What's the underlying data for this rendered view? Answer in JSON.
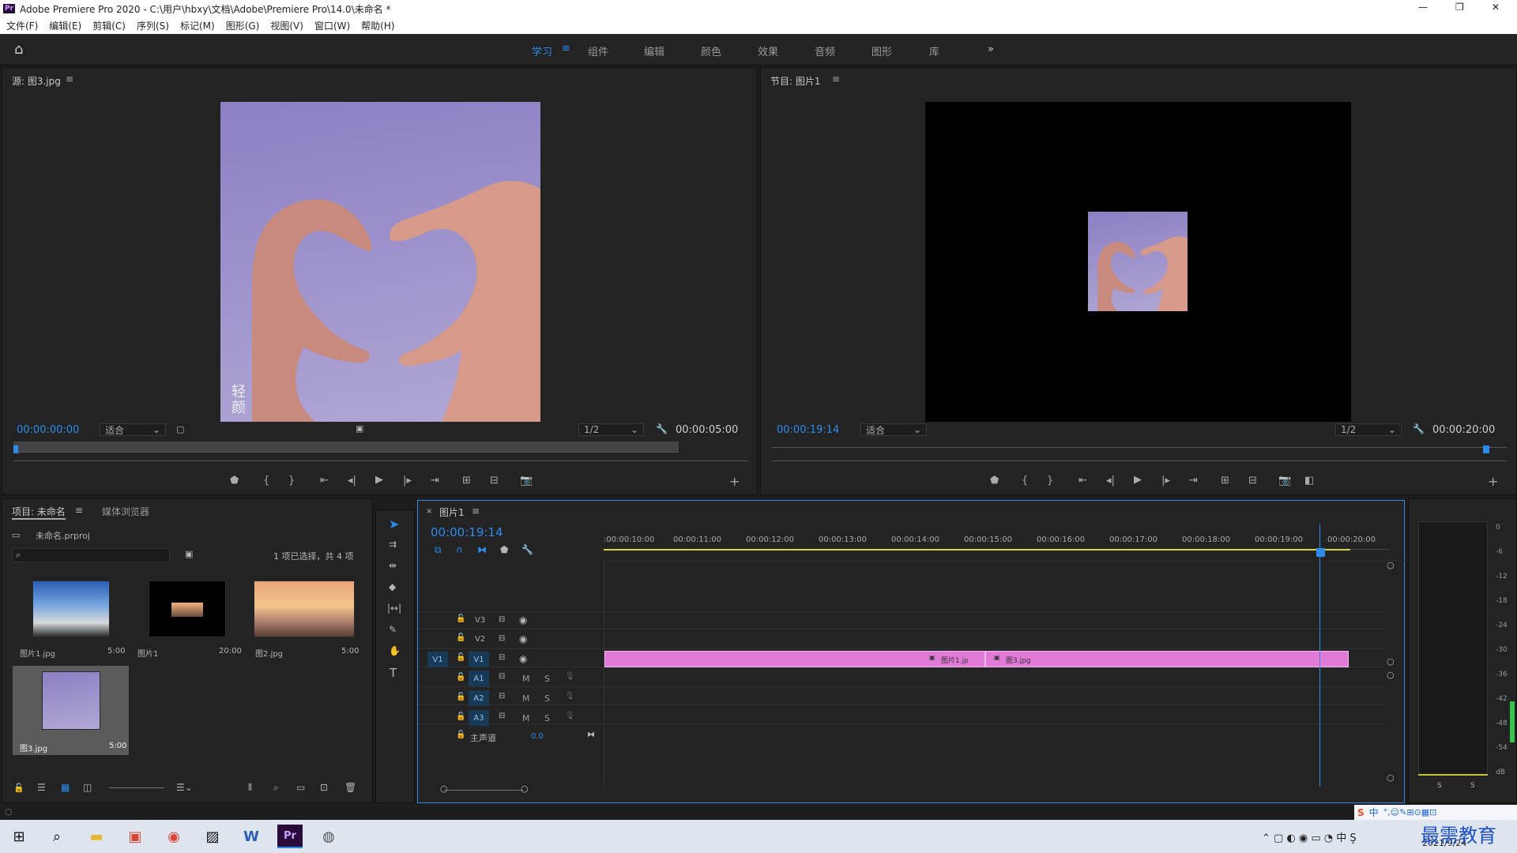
{
  "window": {
    "title": "Adobe Premiere Pro 2020 - C:\\用户\\hbxy\\文档\\Adobe\\Premiere Pro\\14.0\\未命名 *",
    "app_icon": "Pr",
    "min": "—",
    "max": "❐",
    "close": "✕"
  },
  "menu": [
    "文件(F)",
    "编辑(E)",
    "剪辑(C)",
    "序列(S)",
    "标记(M)",
    "图形(G)",
    "视图(V)",
    "窗口(W)",
    "帮助(H)"
  ],
  "workspaces": {
    "items": [
      "学习",
      "组件",
      "编辑",
      "颜色",
      "效果",
      "音频",
      "图形",
      "库"
    ],
    "active": "学习",
    "more": "»"
  },
  "source": {
    "title": "源: 图3.jpg",
    "timecode": "00:00:00:00",
    "fit": "适合",
    "quality": "1/2",
    "duration": "00:00:05:00",
    "watermark": "轻颜"
  },
  "program": {
    "title": "节目: 图片1",
    "timecode": "00:00:19:14",
    "fit": "适合",
    "quality": "1/2",
    "duration": "00:00:20:00"
  },
  "project": {
    "tab_project": "项目: 未命名",
    "tab_media": "媒体浏览器",
    "file": "未命名.prproj",
    "selection": "1 项已选择，共 4 项",
    "items": [
      {
        "name": "图片1.jpg",
        "dur": "5:00"
      },
      {
        "name": "图片1",
        "dur": "20:00"
      },
      {
        "name": "图2.jpg",
        "dur": "5:00"
      },
      {
        "name": "图3.jpg",
        "dur": "5:00"
      }
    ]
  },
  "timeline": {
    "tab": "图片1",
    "timecode": "00:00:19:14",
    "ruler": [
      ":00:00:10:00",
      "00:00:11:00",
      "00:00:12:00",
      "00:00:13:00",
      "00:00:14:00",
      "00:00:15:00",
      "00:00:16:00",
      "00:00:17:00",
      "00:00:18:00",
      "00:00:19:00",
      "00:00:20:00"
    ],
    "video_tracks": [
      "V3",
      "V2",
      "V1"
    ],
    "audio_tracks": [
      "A1",
      "A2",
      "A3"
    ],
    "source_patch": "V1",
    "mute": "M",
    "solo": "S",
    "master_label": "主声道",
    "master_value": "0.0",
    "clips": [
      {
        "label": "图片1.jp"
      },
      {
        "label": "图3.jpg"
      }
    ]
  },
  "meter": {
    "scale": [
      "0",
      "-6",
      "-12",
      "-18",
      "-24",
      "-30",
      "-36",
      "-42",
      "-48",
      "-54",
      "dB"
    ],
    "solo": [
      "S",
      "S"
    ]
  },
  "taskbar": {
    "date": "2021/9/24",
    "ime": "中",
    "brand": "最需教育"
  },
  "colors": {
    "accent": "#2d8ceb",
    "clip": "#e27ad8",
    "playhead": "#2d8ceb"
  }
}
